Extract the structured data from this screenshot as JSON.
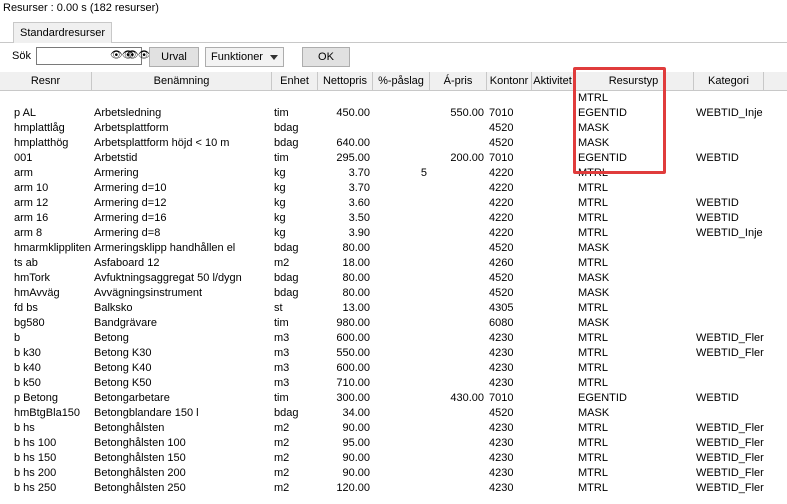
{
  "title": "Resurser : 0.00 s (182 resurser)",
  "tabs": [
    {
      "label": "Standardresurser"
    }
  ],
  "toolbar": {
    "search_label": "Sök",
    "search_value": "",
    "urval_label": "Urval",
    "funktioner_label": "Funktioner",
    "ok_label": "OK"
  },
  "columns": [
    "Resnr",
    "Benämning",
    "Enhet",
    "Nettopris",
    "%-påslag",
    "Á-pris",
    "Kontonr",
    "Aktivitet",
    "Resurstyp",
    "Kategori"
  ],
  "rows": [
    [
      "",
      "",
      "",
      "",
      "",
      "",
      "",
      "",
      "MTRL",
      ""
    ],
    [
      "p AL",
      "Arbetsledning",
      "tim",
      "450.00",
      "",
      "550.00",
      "7010",
      "",
      "EGENTID",
      "WEBTID_Inje"
    ],
    [
      "hmplattlåg",
      "Arbetsplattform",
      "bdag",
      "",
      "",
      "",
      "4520",
      "",
      "MASK",
      ""
    ],
    [
      "hmplatthög",
      "Arbetsplattform höjd < 10 m",
      "bdag",
      "640.00",
      "",
      "",
      "4520",
      "",
      "MASK",
      ""
    ],
    [
      "001",
      "Arbetstid",
      "tim",
      "295.00",
      "",
      "200.00",
      "7010",
      "",
      "EGENTID",
      "WEBTID"
    ],
    [
      "arm",
      "Armering",
      "kg",
      "3.70",
      "5",
      "",
      "4220",
      "",
      "MTRL",
      ""
    ],
    [
      "arm 10",
      "Armering d=10",
      "kg",
      "3.70",
      "",
      "",
      "4220",
      "",
      "MTRL",
      ""
    ],
    [
      "arm 12",
      "Armering d=12",
      "kg",
      "3.60",
      "",
      "",
      "4220",
      "",
      "MTRL",
      "WEBTID"
    ],
    [
      "arm 16",
      "Armering d=16",
      "kg",
      "3.50",
      "",
      "",
      "4220",
      "",
      "MTRL",
      "WEBTID"
    ],
    [
      "arm 8",
      "Armering d=8",
      "kg",
      "3.90",
      "",
      "",
      "4220",
      "",
      "MTRL",
      "WEBTID_Inje"
    ],
    [
      "hmarmklippliten",
      "Armeringsklipp handhållen el",
      "bdag",
      "80.00",
      "",
      "",
      "4520",
      "",
      "MASK",
      ""
    ],
    [
      "ts ab",
      "Asfaboard 12",
      "m2",
      "18.00",
      "",
      "",
      "4260",
      "",
      "MTRL",
      ""
    ],
    [
      "hmTork",
      "Avfuktningsaggregat 50 l/dygn",
      "bdag",
      "80.00",
      "",
      "",
      "4520",
      "",
      "MASK",
      ""
    ],
    [
      "hmAvväg",
      "Avvägningsinstrument",
      "bdag",
      "80.00",
      "",
      "",
      "4520",
      "",
      "MASK",
      ""
    ],
    [
      "fd bs",
      "Balksko",
      "st",
      "13.00",
      "",
      "",
      "4305",
      "",
      "MTRL",
      ""
    ],
    [
      "bg580",
      "Bandgrävare",
      "tim",
      "980.00",
      "",
      "",
      "6080",
      "",
      "MASK",
      ""
    ],
    [
      "b",
      "Betong",
      "m3",
      "600.00",
      "",
      "",
      "4230",
      "",
      "MTRL",
      "WEBTID_Fler"
    ],
    [
      "b k30",
      "Betong K30",
      "m3",
      "550.00",
      "",
      "",
      "4230",
      "",
      "MTRL",
      "WEBTID_Fler"
    ],
    [
      "b k40",
      "Betong K40",
      "m3",
      "600.00",
      "",
      "",
      "4230",
      "",
      "MTRL",
      ""
    ],
    [
      "b k50",
      "Betong K50",
      "m3",
      "710.00",
      "",
      "",
      "4230",
      "",
      "MTRL",
      ""
    ],
    [
      "p Betong",
      "Betongarbetare",
      "tim",
      "300.00",
      "",
      "430.00",
      "7010",
      "",
      "EGENTID",
      "WEBTID"
    ],
    [
      "hmBtgBla150",
      "Betongblandare 150 l",
      "bdag",
      "34.00",
      "",
      "",
      "4520",
      "",
      "MASK",
      ""
    ],
    [
      "b hs",
      "Betonghålsten",
      "m2",
      "90.00",
      "",
      "",
      "4230",
      "",
      "MTRL",
      "WEBTID_Fler"
    ],
    [
      "b hs 100",
      "Betonghålsten 100",
      "m2",
      "95.00",
      "",
      "",
      "4230",
      "",
      "MTRL",
      "WEBTID_Fler"
    ],
    [
      "b hs 150",
      "Betonghålsten 150",
      "m2",
      "90.00",
      "",
      "",
      "4230",
      "",
      "MTRL",
      "WEBTID_Fler"
    ],
    [
      "b hs 200",
      "Betonghålsten 200",
      "m2",
      "90.00",
      "",
      "",
      "4230",
      "",
      "MTRL",
      "WEBTID_Fler"
    ],
    [
      "b hs 250",
      "Betonghålsten 250",
      "m2",
      "120.00",
      "",
      "",
      "4230",
      "",
      "MTRL",
      "WEBTID_Fler"
    ]
  ]
}
